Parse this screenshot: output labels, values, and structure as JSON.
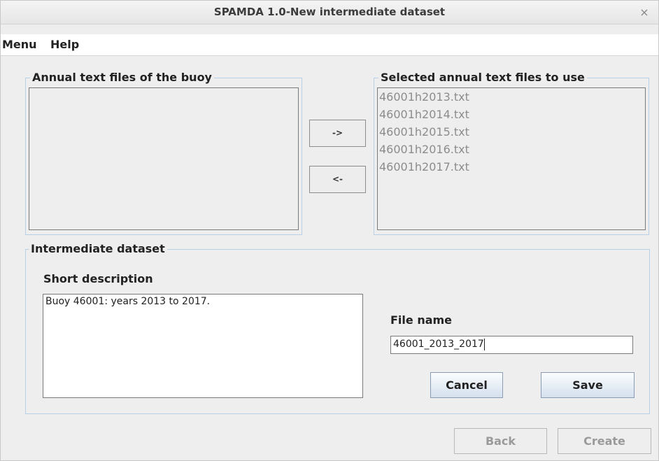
{
  "window": {
    "title": "SPAMDA 1.0-New intermediate dataset",
    "close_glyph": "×"
  },
  "menubar": {
    "items": [
      {
        "label": "Menu"
      },
      {
        "label": "Help"
      }
    ]
  },
  "annual_files": {
    "legend": "Annual text files of the buoy",
    "items": []
  },
  "transfer": {
    "add_label": "->",
    "remove_label": "<-"
  },
  "selected_files": {
    "legend": "Selected annual text files to use",
    "items": [
      {
        "label": "46001h2013.txt"
      },
      {
        "label": "46001h2014.txt"
      },
      {
        "label": "46001h2015.txt"
      },
      {
        "label": "46001h2016.txt"
      },
      {
        "label": "46001h2017.txt"
      }
    ]
  },
  "intermediate": {
    "legend": "Intermediate dataset",
    "description_label": "Short description",
    "description_value": "Buoy 46001: years 2013 to 2017.",
    "filename_label": "File name",
    "filename_value": "46001_2013_2017",
    "cancel_label": "Cancel",
    "save_label": "Save"
  },
  "footer": {
    "back_label": "Back",
    "create_label": "Create"
  }
}
